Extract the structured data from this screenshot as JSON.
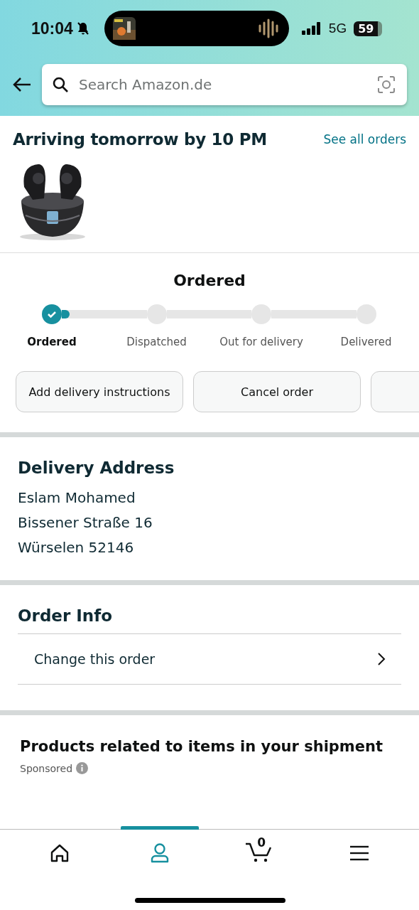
{
  "status_bar": {
    "time": "10:04",
    "network": "5G",
    "battery": "59"
  },
  "search": {
    "placeholder": "Search Amazon.de"
  },
  "header": {
    "title": "Arriving tomorrow by 10 PM",
    "link": "See all orders"
  },
  "product": {
    "kind": "picture"
  },
  "tracker": {
    "title": "Ordered",
    "level": 0.03,
    "steps": [
      {
        "label": "Ordered",
        "selected": true,
        "done": true
      },
      {
        "label": "Dispatched",
        "selected": false,
        "done": false
      },
      {
        "label": "Out for delivery",
        "selected": false,
        "done": false
      },
      {
        "label": "Delivered",
        "selected": false,
        "done": false
      }
    ]
  },
  "actions": [
    "Add delivery instructions",
    "Cancel order"
  ],
  "address": {
    "title": "Delivery Address",
    "lines": [
      "Eslam Mohamed",
      "Bissener Straße 16",
      "Würselen 52146"
    ]
  },
  "order_info": {
    "title": "Order Info",
    "items": [
      "Change this order"
    ]
  },
  "related": {
    "title": "Products related to items in your shipment",
    "note": "Sponsored"
  },
  "nav": [
    {
      "kind": "home",
      "selected": false
    },
    {
      "kind": "account",
      "selected": true
    },
    {
      "kind": "cart",
      "selected": false,
      "count": "0"
    },
    {
      "kind": "menu",
      "selected": false
    }
  ]
}
